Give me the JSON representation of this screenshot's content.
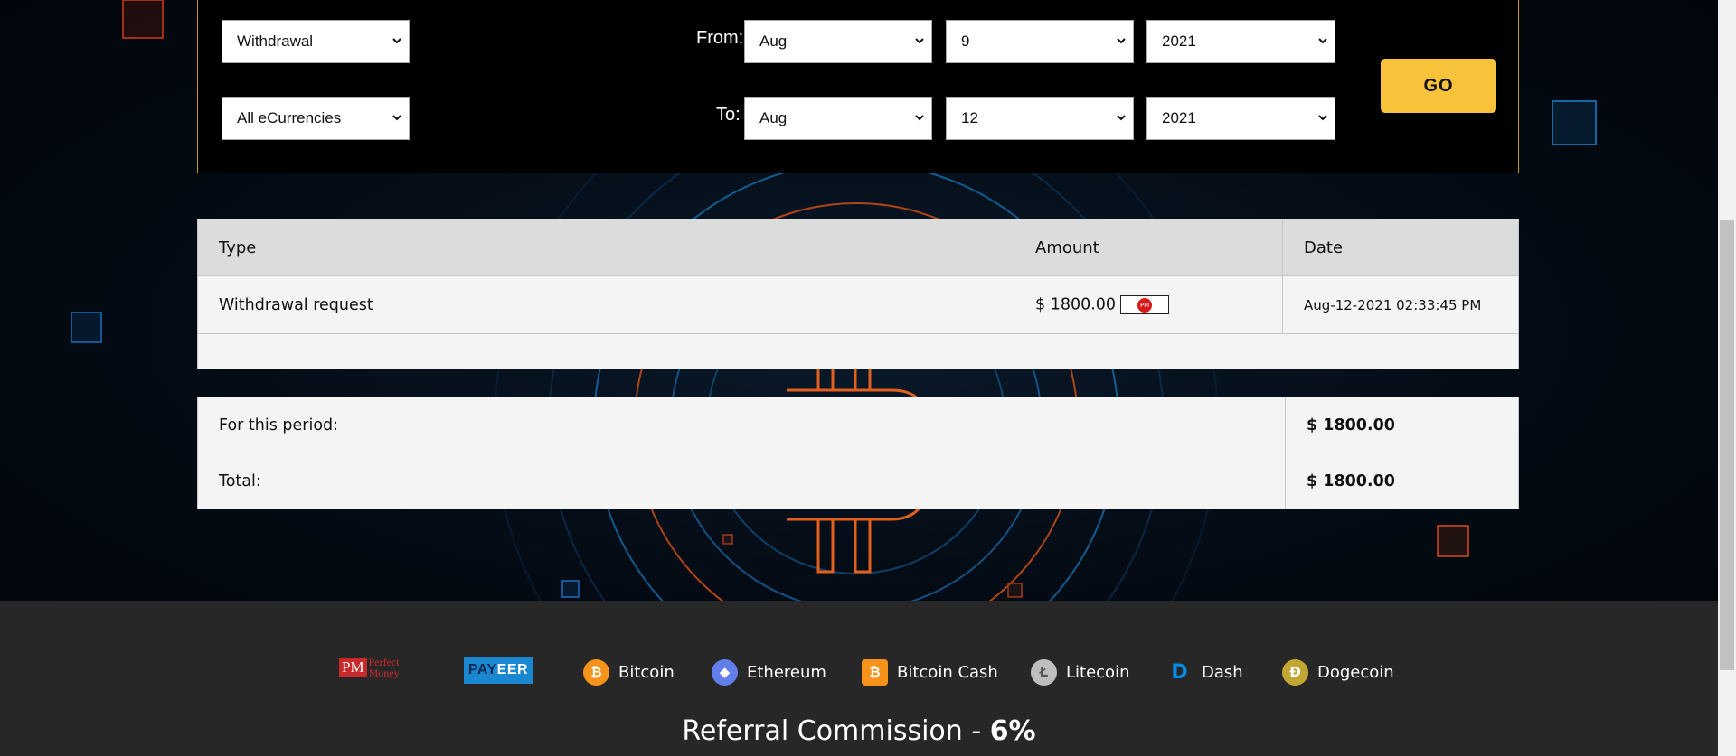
{
  "filter": {
    "type_select": "Withdrawal",
    "currency_select": "All eCurrencies",
    "from_label": "From:",
    "to_label": "To:",
    "from": {
      "month": "Aug",
      "day": "9",
      "year": "2021"
    },
    "to": {
      "month": "Aug",
      "day": "12",
      "year": "2021"
    },
    "go_label": "GO"
  },
  "history": {
    "headers": [
      "Type",
      "Amount",
      "Date"
    ],
    "rows": [
      {
        "type": "Withdrawal request",
        "amount": "$ 1800.00",
        "currency_icon": "perfect-money-icon",
        "date": "Aug-12-2021 02:33:45 PM"
      }
    ]
  },
  "summary": {
    "period_label": "For this period:",
    "period_value": "$ 1800.00",
    "total_label": "Total:",
    "total_value": "$ 1800.00"
  },
  "footer": {
    "payments": [
      {
        "name": "Perfect Money",
        "icon": "perfect-money-logo"
      },
      {
        "name": "PAYEER",
        "icon": "payeer-logo"
      },
      {
        "name": "Bitcoin",
        "icon": "bitcoin-icon",
        "color": "#f7931a"
      },
      {
        "name": "Ethereum",
        "icon": "ethereum-icon",
        "color": "#627eea"
      },
      {
        "name": "Bitcoin Cash",
        "icon": "bitcoin-cash-icon",
        "color": "#f7931a"
      },
      {
        "name": "Litecoin",
        "icon": "litecoin-icon",
        "color": "#bebebe"
      },
      {
        "name": "Dash",
        "icon": "dash-icon",
        "color": "#008ce7"
      },
      {
        "name": "Dogecoin",
        "icon": "dogecoin-icon",
        "color": "#c2a633"
      }
    ],
    "pm_logo_text": "PM",
    "pm_logo_words": "Perfect Money",
    "payeer_pay": "PAY",
    "payeer_eer": "EER",
    "referral_text": "Referral Commission - ",
    "referral_value": "6%"
  },
  "colors": {
    "accent": "#f8c33a",
    "panel_border": "#c69a2a",
    "footer_bg": "#272727"
  }
}
